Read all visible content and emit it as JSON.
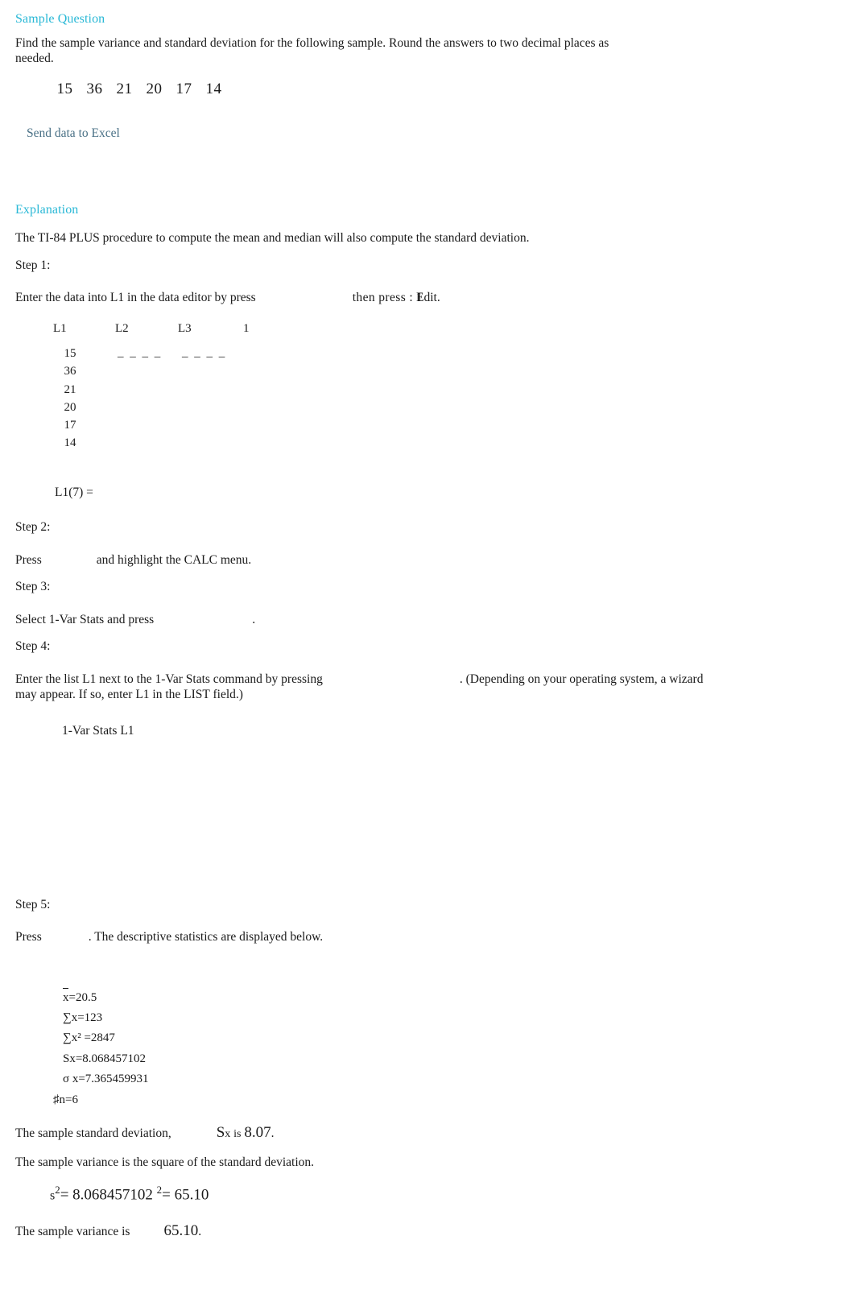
{
  "sample_question": {
    "heading": "Sample Question",
    "prompt": "Find the sample variance and standard deviation for the following sample. Round the answers to two decimal places as needed.",
    "data_values": [
      "15",
      "36",
      "21",
      "20",
      "17",
      "14"
    ],
    "excel_link": "Send data to Excel"
  },
  "explanation": {
    "heading": "Explanation",
    "intro": "The TI-84 PLUS procedure to compute the mean and median will also compute the standard deviation.",
    "steps": [
      {
        "label": "Step 1:",
        "text_before": "Enter the data into L1 in the data editor by press",
        "text_middle": "then  press  :",
        "menu_item_number": "1",
        "menu_item_label": "Edit",
        "text_after": "."
      },
      {
        "label": "Step 2:",
        "text_before": "Press",
        "text_after": "and highlight the CALC menu."
      },
      {
        "label": "Step 3:",
        "text_before": "Select 1-Var Stats and press",
        "text_after": "."
      },
      {
        "label": "Step 4:",
        "text_before": "Enter the list L1 next to the 1-Var Stats command by pressing",
        "text_after": ". (Depending on your operating system, a wizard may appear. If so, enter L1 in the LIST field.)"
      },
      {
        "label": "Step 5:",
        "text_before": "Press",
        "text_after": ". The descriptive statistics are displayed below."
      }
    ]
  },
  "list_editor": {
    "columns": [
      "L1",
      "L2",
      "L3",
      "1"
    ],
    "l1_values": [
      "15",
      "36",
      "21",
      "20",
      "17",
      "14"
    ],
    "empty_marker": "_ _ _ _",
    "cursor_line": "L1(7) ="
  },
  "varstats_command": "1-Var Stats L1",
  "stats_output": {
    "mean_label": "x",
    "mean_value": "=20.5",
    "sum_x": "∑x=123",
    "sum_x_sq_prefix": "∑x² ",
    "sum_x_sq_value": "=2847",
    "sample_sd": "Sx=8.068457102",
    "population_sd": "σ x=7.365459931",
    "n_marker": "♯",
    "n_value": "n=6"
  },
  "conclusion": {
    "sd_text_before": "The sample standard deviation,",
    "sd_symbol": "S",
    "sd_symbol_sub": "x",
    "sd_is_word": "is",
    "sd_value": "8.07",
    "sd_period": ".",
    "variance_intro": "The sample variance is the square of the standard deviation.",
    "formula_s": "s",
    "formula_exp": "2",
    "formula_equals": "=",
    "formula_base": "8.068457102",
    "formula_base_exp": "2",
    "formula_result_equals": "= 65.10",
    "variance_text_before": "The sample variance is",
    "variance_value": "65.10",
    "variance_period": "."
  },
  "colors": {
    "heading": "#29b8d6",
    "link": "#4a7186",
    "text": "#1a1a1a",
    "background": "#ffffff"
  }
}
